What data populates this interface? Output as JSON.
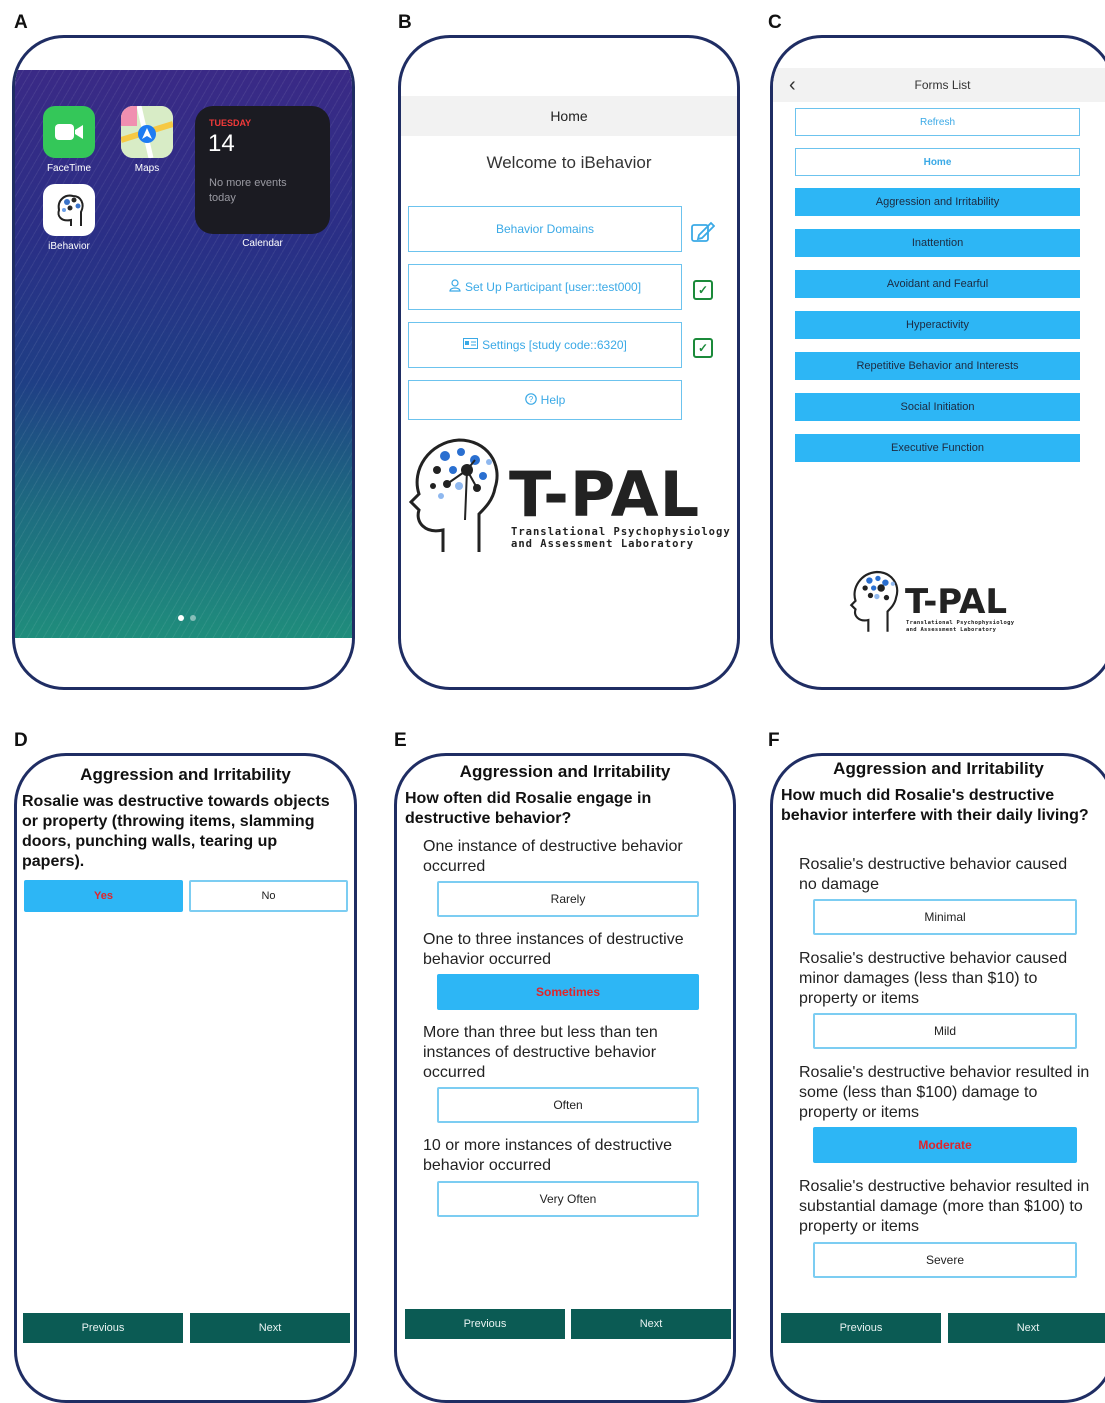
{
  "panel_labels": [
    "A",
    "B",
    "C",
    "D",
    "E",
    "F"
  ],
  "panel_a": {
    "apps": [
      {
        "name": "FaceTime",
        "icon": "facetime-icon",
        "color": "#34c759"
      },
      {
        "name": "Maps",
        "icon": "maps-icon",
        "color": "#e9e6df"
      },
      {
        "name": "iBehavior",
        "icon": "ibehavior-icon",
        "color": "#ffffff"
      }
    ],
    "widget": {
      "day_of_week": "TUESDAY",
      "day": "14",
      "events": "No more events today",
      "name": "Calendar"
    }
  },
  "panel_b": {
    "header": "Home",
    "welcome": "Welcome to iBehavior",
    "buttons": {
      "behavior_domains": "Behavior Domains",
      "setup_participant": "Set Up Participant [user::test000]",
      "settings": "Settings [study code::6320]",
      "help": "Help"
    },
    "logo": {
      "title": "T-PAL",
      "sub1": "Translational Psychophysiology",
      "sub2": "and Assessment Laboratory"
    }
  },
  "panel_c": {
    "header": "Forms List",
    "refresh": "Refresh",
    "home": "Home",
    "forms": [
      "Aggression and Irritability",
      "Inattention",
      "Avoidant and Fearful",
      "Hyperactivity",
      "Repetitive Behavior and Interests",
      "Social Initiation",
      "Executive Function"
    ],
    "logo": {
      "title": "T-PAL",
      "sub1": "Translational Psychophysiology",
      "sub2": "and Assessment Laboratory"
    }
  },
  "panel_d": {
    "title": "Aggression and Irritability",
    "question": "Rosalie was destructive towards objects or property (throwing items, slamming doors, punching walls, tearing up papers).",
    "yes": "Yes",
    "no": "No",
    "previous": "Previous",
    "next": "Next"
  },
  "panel_e": {
    "title": "Aggression and Irritability",
    "question": "How often did Rosalie engage in destructive behavior?",
    "options": [
      {
        "desc": "One instance of destructive behavior occurred",
        "label": "Rarely"
      },
      {
        "desc": "One to three instances of destructive behavior occurred",
        "label": "Sometimes"
      },
      {
        "desc": "More than three but less than ten instances of destructive behavior occurred",
        "label": "Often"
      },
      {
        "desc": "10 or more instances of destructive behavior occurred",
        "label": "Very Often"
      }
    ],
    "previous": "Previous",
    "next": "Next"
  },
  "panel_f": {
    "title": "Aggression and Irritability",
    "question": "How much did Rosalie's destructive behavior interfere with their daily living?",
    "options": [
      {
        "desc": "Rosalie's destructive behavior caused no damage",
        "label": "Minimal"
      },
      {
        "desc": "Rosalie's destructive behavior caused minor damages (less than $10) to property or items",
        "label": "Mild"
      },
      {
        "desc": "Rosalie's destructive behavior resulted in some (less than $100) damage to property or items",
        "label": "Moderate"
      },
      {
        "desc": "Rosalie's destructive behavior resulted in substantial damage (more than $100) to property or items",
        "label": "Severe"
      }
    ],
    "previous": "Previous",
    "next": "Next"
  },
  "colors": {
    "accent": "#2db6f5",
    "nav": "#0b5b54",
    "selected_text": "#e0242a",
    "frame": "#1f2d63"
  }
}
